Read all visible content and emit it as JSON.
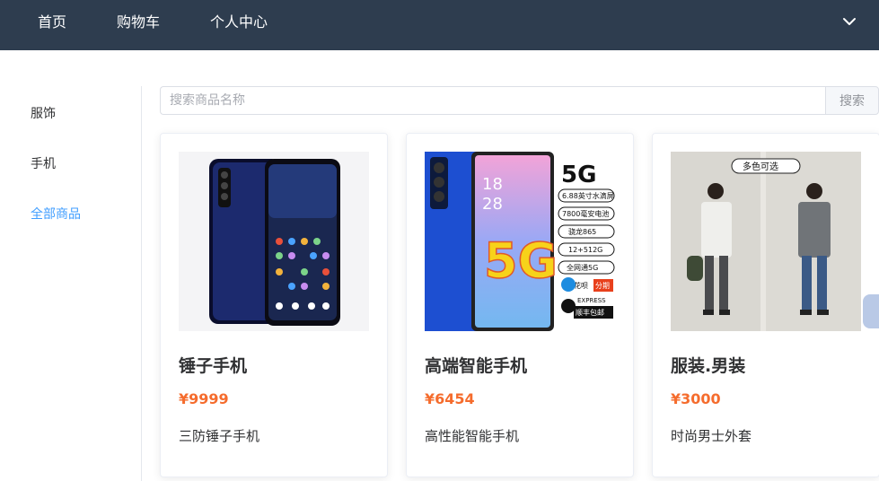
{
  "header": {
    "nav": [
      {
        "label": "首页"
      },
      {
        "label": "购物车"
      },
      {
        "label": "个人中心"
      }
    ],
    "dropdown_icon": "chevron-down-icon"
  },
  "sidebar": {
    "items": [
      {
        "label": "服饰",
        "active": false
      },
      {
        "label": "手机",
        "active": false
      },
      {
        "label": "全部商品",
        "active": true
      }
    ]
  },
  "search": {
    "placeholder": "搜索商品名称",
    "value": "",
    "button_label": "搜索"
  },
  "products": [
    {
      "name": "锤子手机",
      "price": "¥9999",
      "desc": "三防锤子手机",
      "image": "black-smartphone-photo"
    },
    {
      "name": "高端智能手机",
      "price": "¥6454",
      "desc": "高性能智能手机",
      "image": "5g-smartphone-ad-photo",
      "image_text": {
        "badge": "5G",
        "time_hour": "18",
        "time_min": "28",
        "specs": [
          "6.88英寸水滴屏",
          "7800毫安电池",
          "骁龙865",
          "12+512G",
          "全网通5G"
        ],
        "pay": "花呗",
        "pay_tag": "分期",
        "express": "EXPRESS",
        "express_tag": "顺丰包邮",
        "big": "5G"
      }
    },
    {
      "name": "服装.男装",
      "price": "¥3000",
      "desc": "时尚男士外套",
      "image": "mens-jacket-models-photo",
      "image_text": {
        "tag": "多色可选"
      }
    }
  ],
  "colors": {
    "header_bg": "#2e3d4f",
    "active_link": "#409eff",
    "price": "#f56c2d"
  }
}
